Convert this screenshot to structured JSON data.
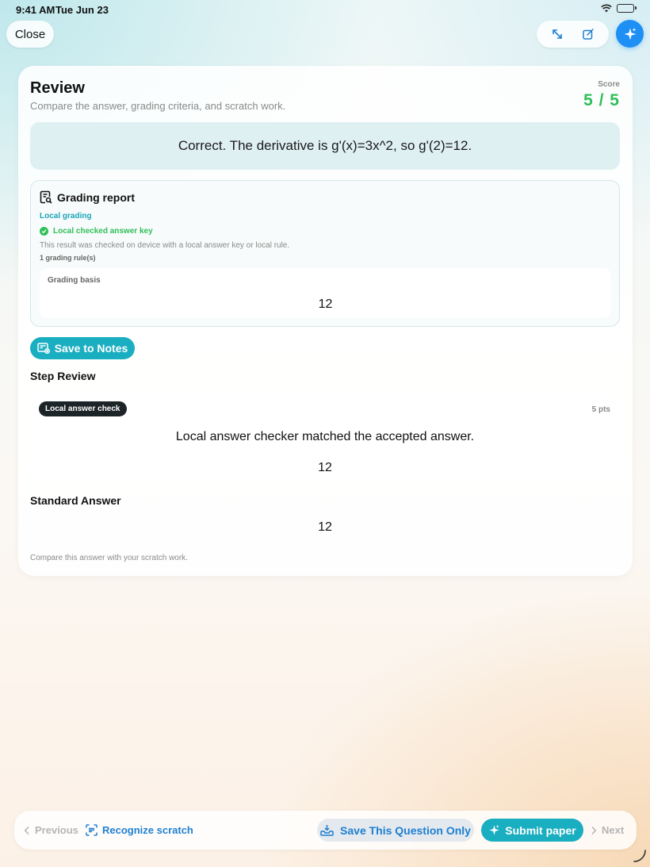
{
  "status_bar": {
    "time": "9:41 AM",
    "date": "Tue Jun 23"
  },
  "toolbar": {
    "close_label": "Close"
  },
  "review": {
    "title": "Review",
    "subtitle": "Compare the answer, grading criteria, and scratch work.",
    "score_label": "Score",
    "score_value": "5 / 5",
    "feedback": "Correct. The derivative is g'(x)=3x^2, so g'(2)=12."
  },
  "grading_report": {
    "title": "Grading report",
    "mode": "Local grading",
    "status": "Local checked answer key",
    "description": "This result was checked on device with a local answer key or local rule.",
    "rule_count": "1 grading rule(s)",
    "basis_label": "Grading basis",
    "basis_value": "12"
  },
  "save_notes_label": "Save to Notes",
  "step_review": {
    "title": "Step Review",
    "tag": "Local answer check",
    "points": "5 pts",
    "message": "Local answer checker matched the accepted answer.",
    "value": "12"
  },
  "standard_answer": {
    "title": "Standard Answer",
    "value": "12",
    "note": "Compare this answer with your scratch work."
  },
  "bottom_bar": {
    "previous_label": "Previous",
    "recognize_label": "Recognize scratch",
    "save_question_label": "Save This Question Only",
    "submit_label": "Submit paper",
    "next_label": "Next"
  },
  "colors": {
    "accent_teal": "#19aec0",
    "accent_blue": "#1e8ff5",
    "success_green": "#2fbf58"
  }
}
